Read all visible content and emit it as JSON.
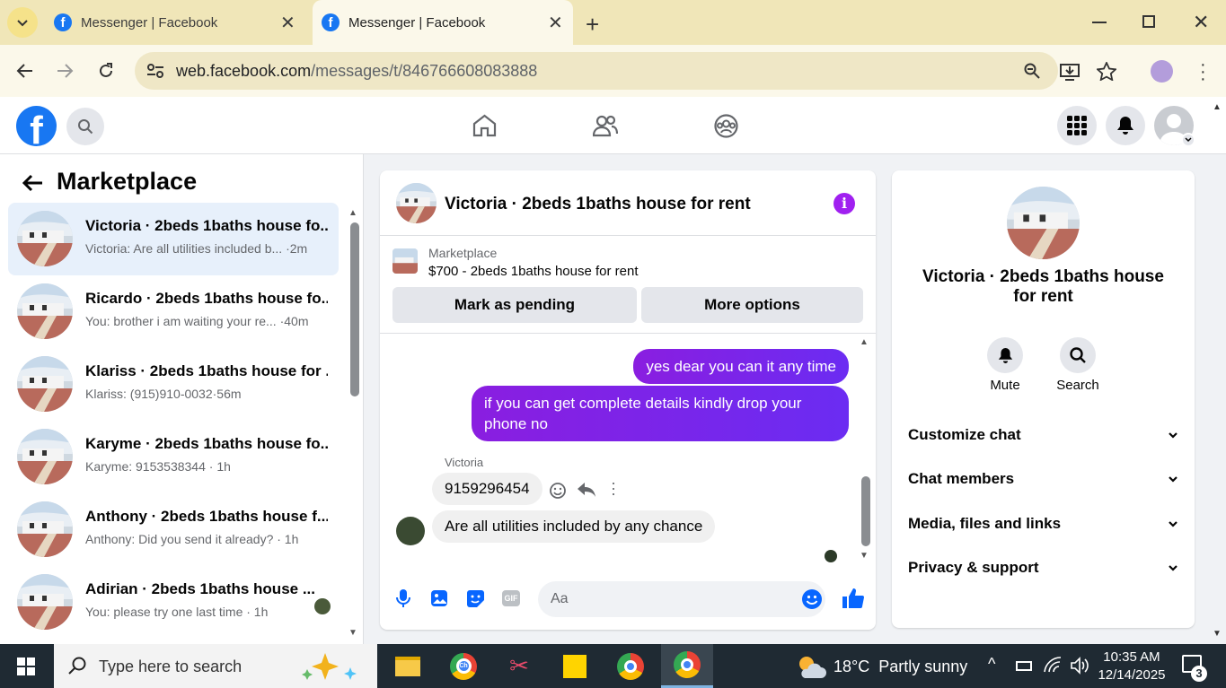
{
  "browser": {
    "tabs": [
      {
        "title": "Messenger | Facebook"
      },
      {
        "title": "Messenger | Facebook"
      }
    ],
    "url_domain": "web.facebook.com",
    "url_path": "/messages/t/846766608083888"
  },
  "fb": {
    "logo_letter": "f"
  },
  "sidebar": {
    "title": "Marketplace",
    "conversations": [
      {
        "name": "Victoria · 2beds 1baths house fo...",
        "preview": "Victoria: Are all utilities included b... ·2m"
      },
      {
        "name": "Ricardo · 2beds 1baths house fo...",
        "preview": "You: brother i am waiting your re... ·40m"
      },
      {
        "name": "Klariss · 2beds 1baths house for ...",
        "preview": "Klariss: (915)910-0032·56m"
      },
      {
        "name": "Karyme · 2beds 1baths house fo...",
        "preview": "Karyme: 9153538344 · 1h"
      },
      {
        "name": "Anthony · 2beds 1baths house f...",
        "preview": "Anthony: Did you send it already? · 1h"
      },
      {
        "name": "Adirian · 2beds 1baths house ...",
        "preview": "You: please try one last time · 1h"
      }
    ]
  },
  "chat": {
    "title": "Victoria · 2beds 1baths house for rent",
    "listing_source": "Marketplace",
    "listing_title": "$700 - 2beds 1baths house for rent",
    "mark_pending": "Mark as pending",
    "more_options": "More options",
    "messages": [
      {
        "from": "me",
        "text": "yes dear you can it any time"
      },
      {
        "from": "me",
        "text": "if you can get complete details  kindly drop your phone no"
      },
      {
        "from": "Victoria",
        "text": "9159296454"
      },
      {
        "from": "Victoria",
        "text": "Are all utilities included by any chance"
      }
    ],
    "sender_name": "Victoria",
    "input_placeholder": "Aa"
  },
  "info": {
    "title": "Victoria · 2beds 1baths house for rent",
    "mute": "Mute",
    "search": "Search",
    "sections": [
      "Customize chat",
      "Chat members",
      "Media, files and links",
      "Privacy & support"
    ]
  },
  "taskbar": {
    "search_placeholder": "Type here to search",
    "weather": "18°C  Partly sunny",
    "time": "10:35 AM",
    "date": "12/14/2025",
    "notifications": "3",
    "chrome_label": "Ch"
  },
  "colors": {
    "fb_blue": "#1877f2",
    "messenger_purple": "#7b2ff0",
    "tab_bar": "#f0e6b8"
  }
}
